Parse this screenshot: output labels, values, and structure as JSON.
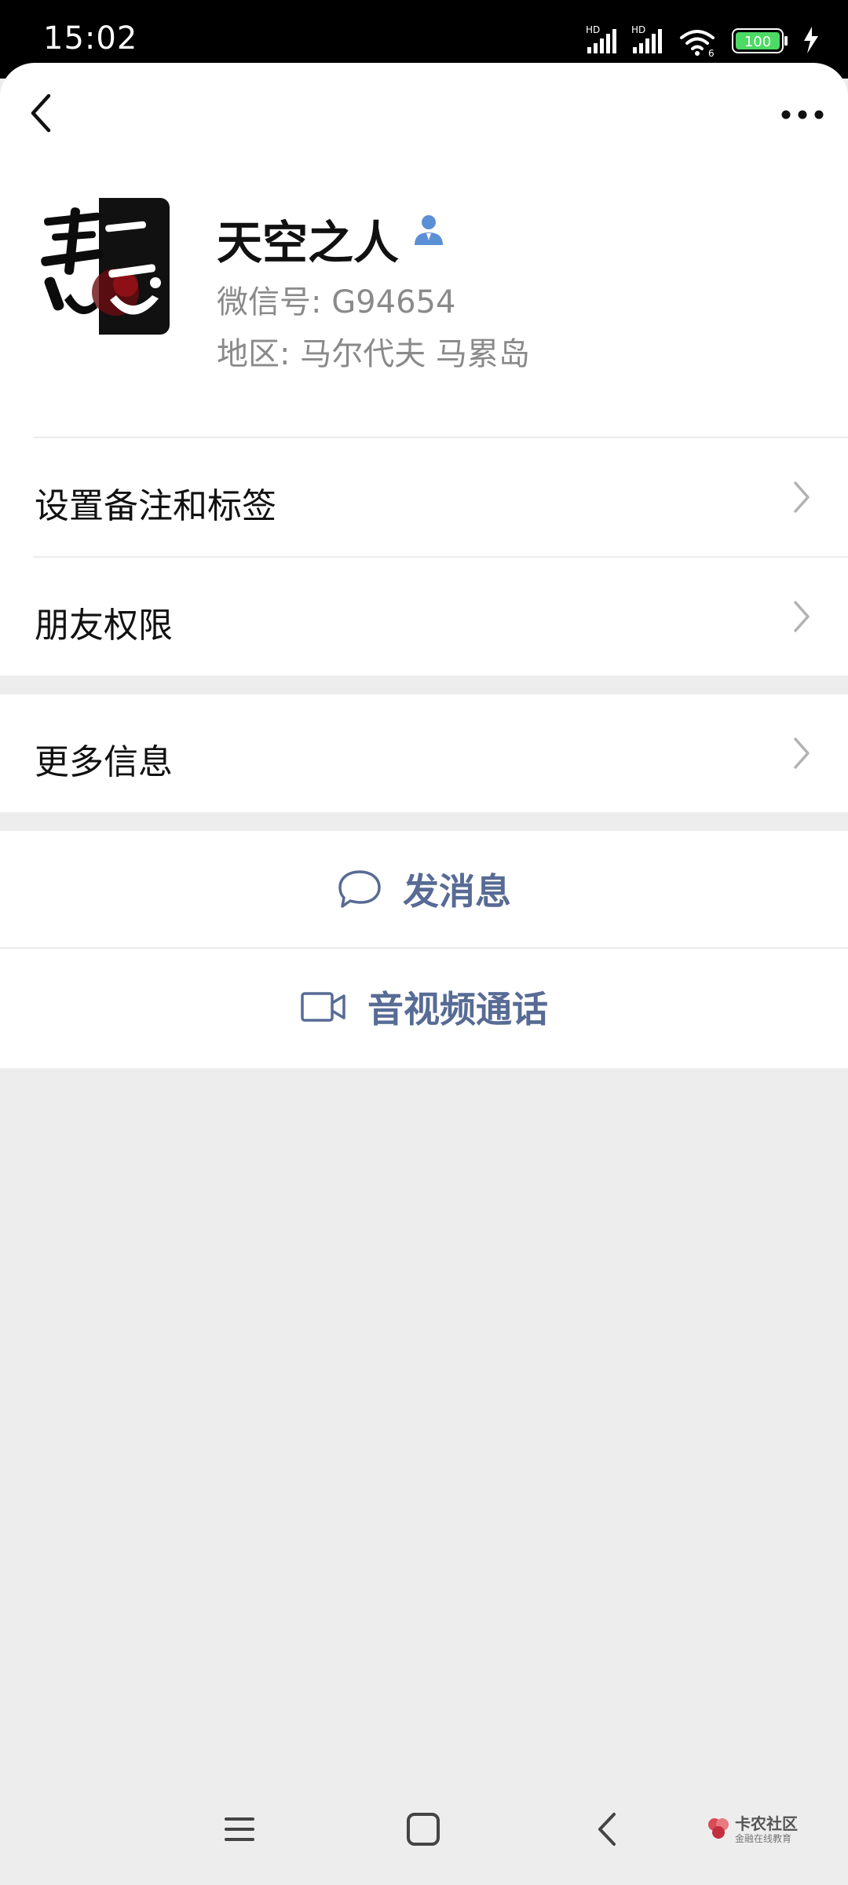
{
  "status_bar": {
    "time": "15:02",
    "signal_labels": [
      "HD",
      "HD"
    ],
    "wifi_label": "6",
    "battery_level": "100"
  },
  "nav": {
    "back_icon": "chevron-left-icon",
    "more_icon": "more-horizontal-icon"
  },
  "profile": {
    "name": "天空之人",
    "wechat_id": "微信号:  G94654",
    "region": "地区:  马尔代夫  马累岛",
    "avatar_char": "悪",
    "verified_icon": "person-icon"
  },
  "menu": {
    "remark_tags": "设置备注和标签",
    "friend_permissions": "朋友权限",
    "more_info": "更多信息"
  },
  "actions": {
    "send_message": "发消息",
    "video_call": "音视频通话"
  },
  "watermark": {
    "title": "卡农社区",
    "subtitle": "金融在线教育"
  },
  "colors": {
    "accent": "#576b95",
    "background": "#ededed",
    "battery": "#4cd964"
  }
}
